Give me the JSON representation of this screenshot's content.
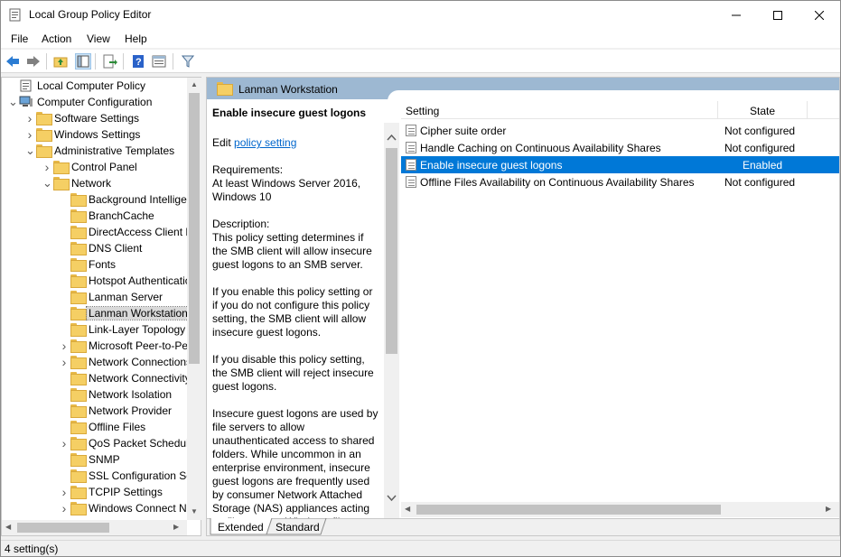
{
  "window": {
    "title": "Local Group Policy Editor"
  },
  "menu": [
    "File",
    "Action",
    "View",
    "Help"
  ],
  "tree": {
    "items": [
      {
        "label": "Local Computer Policy"
      },
      {
        "label": "Computer Configuration"
      },
      {
        "label": "Software Settings"
      },
      {
        "label": "Windows Settings"
      },
      {
        "label": "Administrative Templates"
      },
      {
        "label": "Control Panel"
      },
      {
        "label": "Network"
      },
      {
        "label": "Background Intelligent Transfer Service (BITS)"
      },
      {
        "label": "BranchCache"
      },
      {
        "label": "DirectAccess Client Experience Settings"
      },
      {
        "label": "DNS Client"
      },
      {
        "label": "Fonts"
      },
      {
        "label": "Hotspot Authentication"
      },
      {
        "label": "Lanman Server"
      },
      {
        "label": "Lanman Workstation"
      },
      {
        "label": "Link-Layer Topology Discovery"
      },
      {
        "label": "Microsoft Peer-to-Peer Networking Services"
      },
      {
        "label": "Network Connections"
      },
      {
        "label": "Network Connectivity Status Indicator"
      },
      {
        "label": "Network Isolation"
      },
      {
        "label": "Network Provider"
      },
      {
        "label": "Offline Files"
      },
      {
        "label": "QoS Packet Scheduler"
      },
      {
        "label": "SNMP"
      },
      {
        "label": "SSL Configuration Settings"
      },
      {
        "label": "TCPIP Settings"
      },
      {
        "label": "Windows Connect Now"
      }
    ]
  },
  "header": {
    "folder": "Lanman Workstation"
  },
  "description": {
    "heading": "Enable insecure guest logons",
    "edit_prefix": "Edit ",
    "edit_link": "policy setting",
    "requirements": "Requirements:\nAt least Windows Server 2016, Windows 10",
    "desc1": "Description:\nThis policy setting determines if the SMB client will allow insecure guest logons to an SMB server.",
    "desc2": "If you enable this policy setting or if you do not configure this policy setting, the SMB client will allow insecure guest logons.",
    "desc3": "If you disable this policy setting, the SMB client will reject insecure guest logons.",
    "desc4": "Insecure guest logons are used by file servers to allow unauthenticated access to shared folders. While uncommon in an enterprise environment, insecure guest logons are frequently used by consumer Network Attached Storage (NAS) appliances acting as file servers. Windows file"
  },
  "list": {
    "col_setting": "Setting",
    "col_state": "State",
    "rows": [
      {
        "name": "Cipher suite order",
        "state": "Not configured"
      },
      {
        "name": "Handle Caching on Continuous Availability Shares",
        "state": "Not configured"
      },
      {
        "name": "Enable insecure guest logons",
        "state": "Enabled"
      },
      {
        "name": "Offline Files Availability on Continuous Availability Shares",
        "state": "Not configured"
      }
    ]
  },
  "tabs": [
    "Extended",
    "Standard"
  ],
  "status": "4 setting(s)",
  "colors": {
    "selection": "#0078d7",
    "header_band": "#9db8d2",
    "link": "#0066cc"
  }
}
